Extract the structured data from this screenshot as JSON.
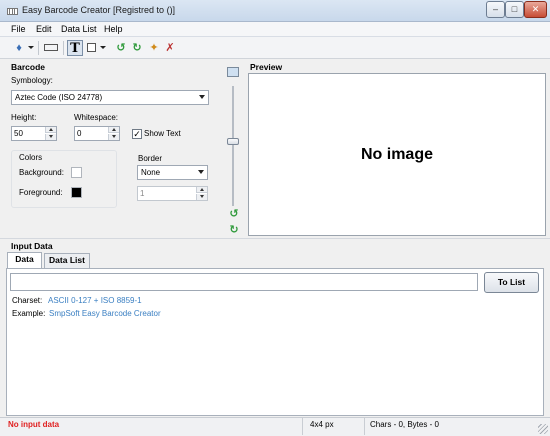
{
  "window": {
    "title": "Easy Barcode Creator [Registred to  ()]"
  },
  "menu": [
    "File",
    "Edit",
    "Data List",
    "Help"
  ],
  "barcode": {
    "section_title": "Barcode",
    "symbology_label": "Symbology:",
    "symbology_value": "Aztec Code (ISO 24778)",
    "height_label": "Height:",
    "height_value": "50",
    "whitespace_label": "Whitespace:",
    "whitespace_value": "0",
    "show_text_label": "Show Text",
    "colors_title": "Colors",
    "background_label": "Background:",
    "foreground_label": "Foreground:",
    "background_color": "#ffffff",
    "foreground_color": "#000000",
    "border_title": "Border",
    "border_value": "None",
    "border_width_value": "1"
  },
  "preview": {
    "title": "Preview",
    "placeholder": "No image"
  },
  "input_data": {
    "section_title": "Input Data",
    "tabs": [
      "Data",
      "Data List"
    ],
    "to_list_label": "To List",
    "charset_label": "Charset:",
    "charset_value": "ASCII 0-127 + ISO 8859-1",
    "example_label": "Example:",
    "example_value": "SmpSoft Easy Barcode Creator"
  },
  "status": {
    "message": "No input data",
    "size": "4x4 px",
    "counts": "Chars - 0, Bytes - 0"
  },
  "colors": {
    "status_error": "#e02020",
    "info_link": "#3a7fc2"
  }
}
